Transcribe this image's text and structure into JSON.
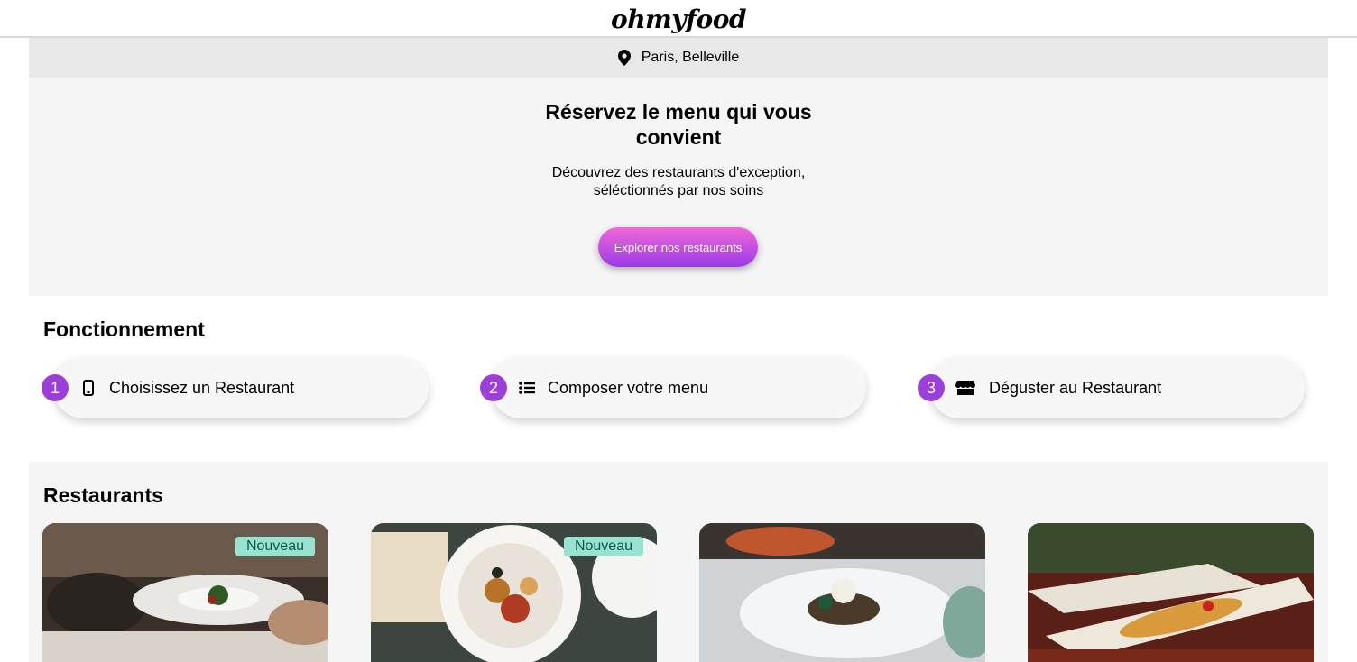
{
  "header": {
    "logo": "ohmyfood"
  },
  "location": {
    "text": "Paris, Belleville",
    "icon": "map-pin-icon"
  },
  "hero": {
    "title": "Réservez le menu qui vous convient",
    "subtitle": "Découvrez des restaurants d'exception, séléctionnés par nos soins",
    "cta_label": "Explorer nos restaurants"
  },
  "how": {
    "title": "Fonctionnement",
    "steps": [
      {
        "num": "1",
        "label": "Choisissez un Restaurant",
        "icon": "mobile-phone-icon"
      },
      {
        "num": "2",
        "label": "Composer votre menu",
        "icon": "list-icon"
      },
      {
        "num": "3",
        "label": "Déguster au Restaurant",
        "icon": "store-icon"
      }
    ]
  },
  "restaurants": {
    "title": "Restaurants",
    "cards": [
      {
        "badge": "Nouveau"
      },
      {
        "badge": "Nouveau"
      },
      {
        "badge": ""
      },
      {
        "badge": ""
      }
    ]
  },
  "colors": {
    "accent": "#9c3fda",
    "cta_top": "#f168d8",
    "cta_bottom": "#9a39e6",
    "badge": "#99e2d0"
  }
}
